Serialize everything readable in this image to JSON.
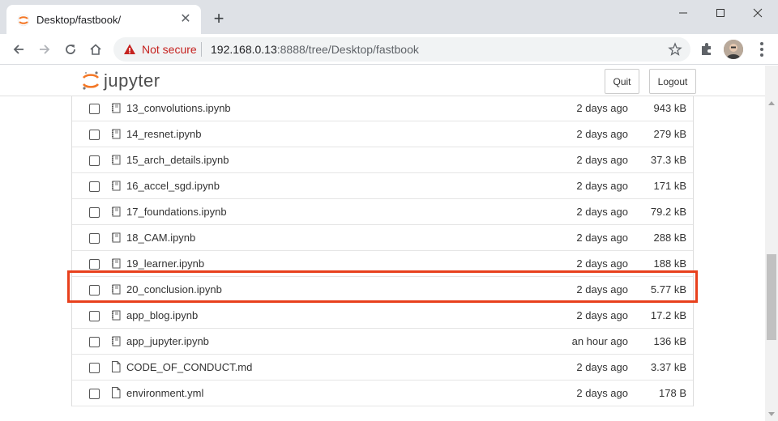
{
  "browser": {
    "tab_title": "Desktop/fastbook/",
    "new_tab_label": "+",
    "security_label": "Not secure",
    "url_host": "192.168.0.13",
    "url_rest": ":8888/tree/Desktop/fastbook"
  },
  "header": {
    "logo_text": "jupyter",
    "quit_label": "Quit",
    "logout_label": "Logout"
  },
  "files": [
    {
      "name": "13_convolutions.ipynb",
      "modified": "2 days ago",
      "size": "943 kB",
      "icon": "notebook-icon"
    },
    {
      "name": "14_resnet.ipynb",
      "modified": "2 days ago",
      "size": "279 kB",
      "icon": "notebook-icon"
    },
    {
      "name": "15_arch_details.ipynb",
      "modified": "2 days ago",
      "size": "37.3 kB",
      "icon": "notebook-icon"
    },
    {
      "name": "16_accel_sgd.ipynb",
      "modified": "2 days ago",
      "size": "171 kB",
      "icon": "notebook-icon"
    },
    {
      "name": "17_foundations.ipynb",
      "modified": "2 days ago",
      "size": "79.2 kB",
      "icon": "notebook-icon"
    },
    {
      "name": "18_CAM.ipynb",
      "modified": "2 days ago",
      "size": "288 kB",
      "icon": "notebook-icon"
    },
    {
      "name": "19_learner.ipynb",
      "modified": "2 days ago",
      "size": "188 kB",
      "icon": "notebook-icon"
    },
    {
      "name": "20_conclusion.ipynb",
      "modified": "2 days ago",
      "size": "5.77 kB",
      "icon": "notebook-icon"
    },
    {
      "name": "app_blog.ipynb",
      "modified": "2 days ago",
      "size": "17.2 kB",
      "icon": "notebook-icon"
    },
    {
      "name": "app_jupyter.ipynb",
      "modified": "an hour ago",
      "size": "136 kB",
      "icon": "notebook-icon"
    },
    {
      "name": "CODE_OF_CONDUCT.md",
      "modified": "2 days ago",
      "size": "3.37 kB",
      "icon": "file-icon"
    },
    {
      "name": "environment.yml",
      "modified": "2 days ago",
      "size": "178 B",
      "icon": "file-icon"
    }
  ],
  "colors": {
    "highlight": "#e8401c",
    "jupyter_orange": "#f37726",
    "warning_red": "#c5221f"
  }
}
